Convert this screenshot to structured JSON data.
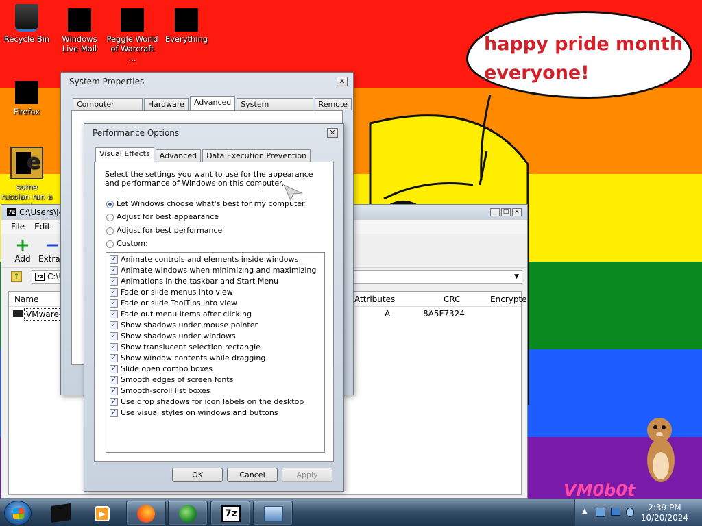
{
  "wallpaper": {
    "stripes": [
      "#ff1a10",
      "#ff8a00",
      "#ffee00",
      "#0a8a1e",
      "#1d5cff",
      "#7a1aa8"
    ],
    "bubble_text": "happy pride month everyone!",
    "watermark": "VM0b0t"
  },
  "desktop_icons": [
    {
      "label": "Recycle Bin",
      "icon": "recycle-bin-icon"
    },
    {
      "label": "Windows Live Mail",
      "icon": "windows-live-mail-icon"
    },
    {
      "label": "Peggle World of Warcraft ...",
      "icon": "peggle-icon"
    },
    {
      "label": "Everything",
      "icon": "everything-search-icon"
    },
    {
      "label": "Firefox",
      "icon": "firefox-icon"
    },
    {
      "label": "some russian ran a rat",
      "icon": "internet-explorer-icon"
    }
  ],
  "system_properties": {
    "title": "System Properties",
    "tabs": [
      "Computer Name",
      "Hardware",
      "Advanced",
      "System Protection",
      "Remote"
    ],
    "active_tab": "Advanced"
  },
  "performance_options": {
    "title": "Performance Options",
    "tabs": [
      "Visual Effects",
      "Advanced",
      "Data Execution Prevention"
    ],
    "active_tab": "Visual Effects",
    "description": "Select the settings you want to use for the appearance and performance of Windows on this computer.",
    "radios": [
      {
        "label": "Let Windows choose what's best for my computer",
        "selected": true
      },
      {
        "label": "Adjust for best appearance",
        "selected": false
      },
      {
        "label": "Adjust for best performance",
        "selected": false
      },
      {
        "label": "Custom:",
        "selected": false
      }
    ],
    "checkboxes": [
      "Animate controls and elements inside windows",
      "Animate windows when minimizing and maximizing",
      "Animations in the taskbar and Start Menu",
      "Fade or slide menus into view",
      "Fade or slide ToolTips into view",
      "Fade out menu items after clicking",
      "Show shadows under mouse pointer",
      "Show shadows under windows",
      "Show translucent selection rectangle",
      "Show window contents while dragging",
      "Slide open combo boxes",
      "Smooth edges of screen fonts",
      "Smooth-scroll list boxes",
      "Use drop shadows for icon labels on the desktop",
      "Use visual styles on windows and buttons"
    ],
    "buttons": {
      "ok": "OK",
      "cancel": "Cancel",
      "apply": "Apply"
    }
  },
  "sevenzip": {
    "title": "C:\\Users\\Je",
    "menu": [
      "File",
      "Edit",
      "V"
    ],
    "toolbar": {
      "add": "Add",
      "extract": "Extract"
    },
    "address": "C:\\U",
    "columns": {
      "name": "Name",
      "attributes": "Attributes",
      "crc": "CRC",
      "encrypted": "Encrypte"
    },
    "row": {
      "name": "VMware-w",
      "attributes": "A",
      "crc": "8A5F7324"
    }
  },
  "taskbar": {
    "time": "2:39 PM",
    "date": "10/20/2024",
    "sevenzip_label": "7z"
  }
}
